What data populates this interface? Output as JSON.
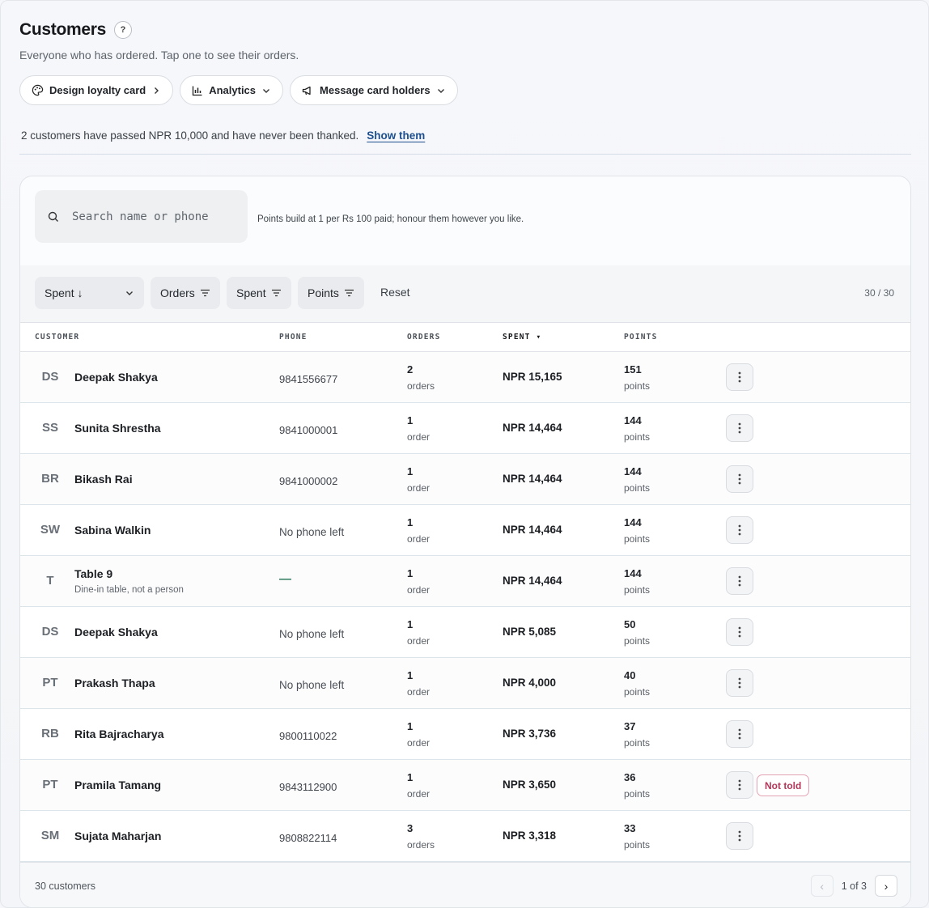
{
  "header": {
    "title": "Customers",
    "help": "?",
    "subtitle": "Everyone who has ordered. Tap one to see their orders."
  },
  "actions": {
    "loyalty": "Design loyalty card",
    "analytics": "Analytics",
    "message": "Message card holders"
  },
  "notice": {
    "text": "2 customers have passed NPR 10,000 and have never been thanked.",
    "link": "Show them"
  },
  "search": {
    "placeholder": "Search name or phone",
    "hint": "Points build at 1 per Rs 100 paid; honour them however you like."
  },
  "filters": {
    "sort": "Spent ↓",
    "orders": "Orders",
    "spent": "Spent",
    "points": "Points",
    "reset": "Reset",
    "count": "30 / 30"
  },
  "columns": {
    "customer": "CUSTOMER",
    "phone": "PHONE",
    "orders": "ORDERS",
    "spent": "SPENT ▾",
    "points": "POINTS"
  },
  "rows": [
    {
      "initials": "DS",
      "name": "Deepak Shakya",
      "note": "",
      "phone": "9841556677",
      "orders": "2",
      "orders_unit": "orders",
      "spent": "NPR 15,165",
      "points": "151",
      "points_unit": "points",
      "badge": ""
    },
    {
      "initials": "SS",
      "name": "Sunita Shrestha",
      "note": "",
      "phone": "9841000001",
      "orders": "1",
      "orders_unit": "order",
      "spent": "NPR 14,464",
      "points": "144",
      "points_unit": "points",
      "badge": ""
    },
    {
      "initials": "BR",
      "name": "Bikash Rai",
      "note": "",
      "phone": "9841000002",
      "orders": "1",
      "orders_unit": "order",
      "spent": "NPR 14,464",
      "points": "144",
      "points_unit": "points",
      "badge": ""
    },
    {
      "initials": "SW",
      "name": "Sabina Walkin",
      "note": "",
      "phone": "No phone left",
      "orders": "1",
      "orders_unit": "order",
      "spent": "NPR 14,464",
      "points": "144",
      "points_unit": "points",
      "badge": ""
    },
    {
      "initials": "T",
      "name": "Table 9",
      "note": "Dine-in table, not a person",
      "phone": "—",
      "orders": "1",
      "orders_unit": "order",
      "spent": "NPR 14,464",
      "points": "144",
      "points_unit": "points",
      "badge": ""
    },
    {
      "initials": "DS",
      "name": "Deepak Shakya",
      "note": "",
      "phone": "No phone left",
      "orders": "1",
      "orders_unit": "order",
      "spent": "NPR 5,085",
      "points": "50",
      "points_unit": "points",
      "badge": ""
    },
    {
      "initials": "PT",
      "name": "Prakash Thapa",
      "note": "",
      "phone": "No phone left",
      "orders": "1",
      "orders_unit": "order",
      "spent": "NPR 4,000",
      "points": "40",
      "points_unit": "points",
      "badge": ""
    },
    {
      "initials": "RB",
      "name": "Rita Bajracharya",
      "note": "",
      "phone": "9800110022",
      "orders": "1",
      "orders_unit": "order",
      "spent": "NPR 3,736",
      "points": "37",
      "points_unit": "points",
      "badge": ""
    },
    {
      "initials": "PT",
      "name": "Pramila Tamang",
      "note": "",
      "phone": "9843112900",
      "orders": "1",
      "orders_unit": "order",
      "spent": "NPR 3,650",
      "points": "36",
      "points_unit": "points",
      "badge": "Not told"
    },
    {
      "initials": "SM",
      "name": "Sujata Maharjan",
      "note": "",
      "phone": "9808822114",
      "orders": "3",
      "orders_unit": "orders",
      "spent": "NPR 3,318",
      "points": "33",
      "points_unit": "points",
      "badge": ""
    }
  ],
  "footer": {
    "total": "30 customers",
    "prev": "‹",
    "page": "1 of 3",
    "next": "›"
  }
}
